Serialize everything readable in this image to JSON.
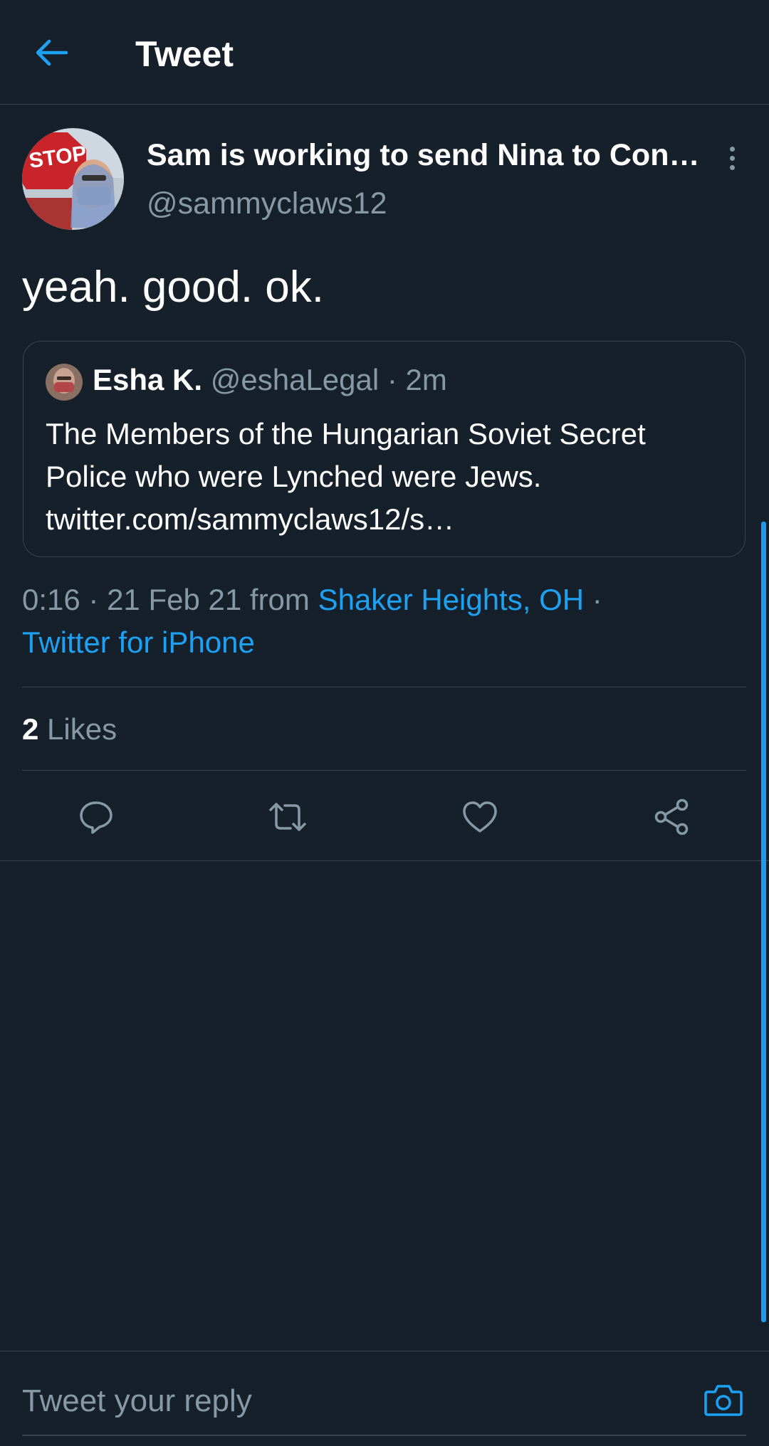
{
  "header": {
    "title": "Tweet",
    "back_icon": "arrow-left-icon"
  },
  "tweet": {
    "display_name": "Sam is working to send Nina to Con…",
    "handle": "@sammyclaws12",
    "avatar_sign_text": "STOP",
    "text": "yeah. good. ok.",
    "quote": {
      "display_name": "Esha K.",
      "handle": "@eshaLegal",
      "separator": " · ",
      "time": "2m",
      "line1": "The Members of the Hungarian Soviet Secret",
      "line2": "Police who were Lynched were Jews.",
      "line3": "twitter.com/sammyclaws12/s…"
    },
    "meta": {
      "time": "0:16",
      "dot": " · ",
      "date": "21 Feb 21",
      "from": " from ",
      "location": "Shaker Heights, OH",
      "dot2": " ·",
      "source": "Twitter for iPhone"
    },
    "likes": {
      "count": "2",
      "label": " Likes"
    }
  },
  "actions": [
    "reply-icon",
    "retweet-icon",
    "like-icon",
    "share-icon"
  ],
  "reply": {
    "placeholder": "Tweet your reply",
    "camera_icon": "camera-icon"
  },
  "colors": {
    "background": "#15202b",
    "accent": "#1da1f2",
    "muted_text": "#8899a6",
    "divider": "#38444d"
  }
}
